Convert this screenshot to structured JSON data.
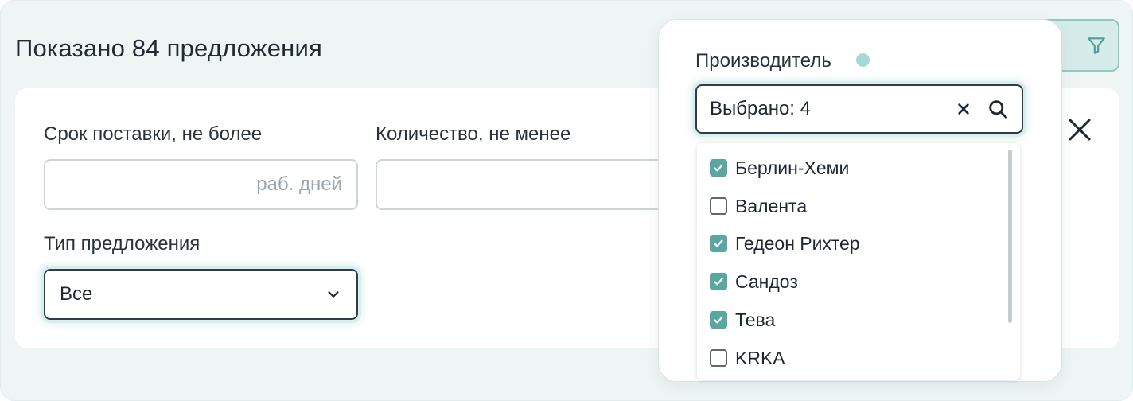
{
  "results": {
    "title": "Показано 84 предложения"
  },
  "filters": {
    "delivery": {
      "label": "Срок поставки, не более",
      "placeholder": "раб. дней"
    },
    "quantity": {
      "label": "Количество, не менее"
    },
    "offer_type": {
      "label": "Тип предложения",
      "value": "Все"
    }
  },
  "manufacturer": {
    "label": "Производитель",
    "search_value": "Выбрано: 4",
    "items": [
      {
        "label": "Берлин-Хеми",
        "checked": true
      },
      {
        "label": "Валента",
        "checked": false
      },
      {
        "label": "Гедеон Рихтер",
        "checked": true
      },
      {
        "label": "Сандоз",
        "checked": true
      },
      {
        "label": "Тева",
        "checked": true
      },
      {
        "label": "KRKA",
        "checked": false
      }
    ]
  },
  "colors": {
    "accent": "#5aa7a2",
    "accent_light": "#d6ecea",
    "text": "#1f2732",
    "placeholder": "#9aa6b2"
  },
  "icons": {
    "filter_toggle": "filter-icon",
    "close": "close-icon",
    "select": "chevron-down-icon",
    "clear": "clear-icon",
    "search": "search-icon",
    "check": "checkmark-icon"
  }
}
